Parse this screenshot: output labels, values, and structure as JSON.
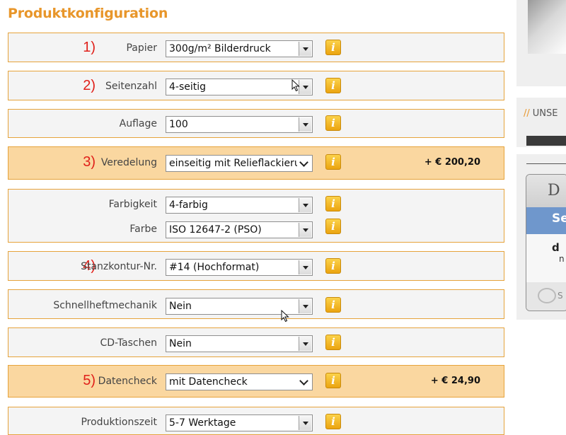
{
  "page_title": "Produktkonfiguration",
  "rows": {
    "papier": {
      "number": "1)",
      "label": "Papier",
      "value": "300g/m² Bilderdruck",
      "info": "i"
    },
    "seitenzahl": {
      "number": "2)",
      "label": "Seitenzahl",
      "value": "4-seitig",
      "info": "i"
    },
    "auflage": {
      "label": "Auflage",
      "value": "100",
      "info": "i"
    },
    "veredelung": {
      "number": "3)",
      "label": "Veredelung",
      "value": "einseitig mit Relieflackierung",
      "info": "i",
      "price": "+ € 200,20"
    },
    "farbigkeit": {
      "label": "Farbigkeit",
      "value": "4-farbig",
      "info": "i"
    },
    "farbe": {
      "label": "Farbe",
      "value": "ISO 12647-2 (PSO)",
      "info": "i"
    },
    "stanzkontur": {
      "number": "4)",
      "label": "Stanzkontur-Nr.",
      "value": "#14 (Hochformat)",
      "info": "i"
    },
    "schnellheft": {
      "label": "Schnellheftmechanik",
      "value": "Nein",
      "info": "i"
    },
    "cdtaschen": {
      "label": "CD-Taschen",
      "value": "Nein",
      "info": "i"
    },
    "datencheck": {
      "number": "5)",
      "label": "Datencheck",
      "value": "mit Datencheck",
      "info": "i",
      "price": "+ € 24,90"
    },
    "produktionszeit": {
      "label": "Produktionszeit",
      "value": "5-7 Werktage",
      "info": "i"
    }
  },
  "sidebar": {
    "heading_slashes": "//",
    "heading": "UNSE",
    "ad_top": "D",
    "ad_blue": "Se",
    "ad_word": "d",
    "ad_word2": "n",
    "ad_foot": "S"
  },
  "colors": {
    "accent": "#e8962a",
    "row_border": "#e6a33b",
    "row_bg": "#f4f4f4",
    "row_highlight": "#fad7a0",
    "step_number": "#e0201a",
    "info_icon": "#f0b020"
  },
  "icons": {
    "info": "info-icon",
    "dropdown": "chevron-down-icon",
    "cursor": "mouse-pointer-icon"
  }
}
